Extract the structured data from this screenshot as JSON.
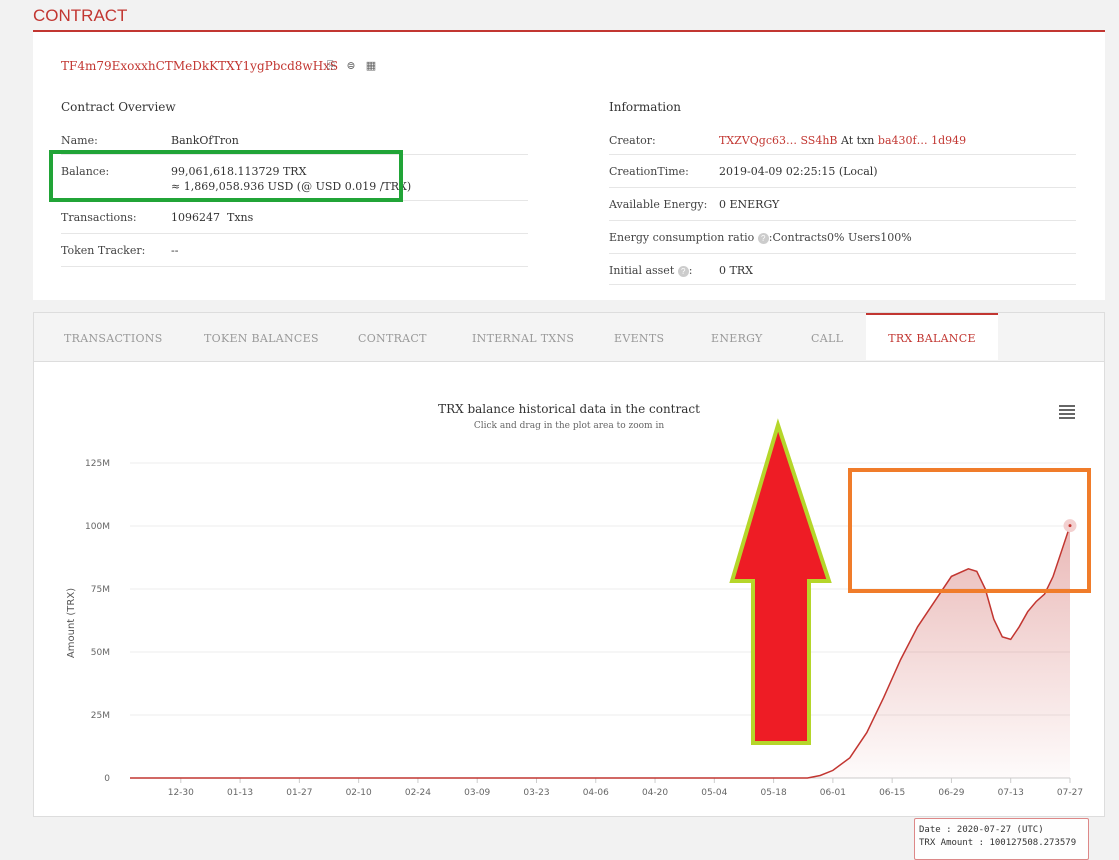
{
  "header": {
    "title": "CONTRACT"
  },
  "contract": {
    "address": "TF4m79ExoxxhCTMeDkKTXY1ygPbcd8wHxS"
  },
  "overview": {
    "title": "Contract Overview",
    "name_label": "Name:",
    "name_value": "BankOfTron",
    "balance_label": "Balance:",
    "balance_trx": "99,061,618.113729 TRX",
    "balance_usd": "≈ 1,869,058.936 USD (@ USD 0.019 /TRX)",
    "tx_label": "Transactions:",
    "tx_count": "1096247",
    "tx_unit": "Txns",
    "token_label": "Token Tracker:",
    "token_value": "--"
  },
  "information": {
    "title": "Information",
    "creator_label": "Creator:",
    "creator_value": "TXZVQgc63… SS4hB",
    "creator_at": "At txn",
    "creator_txn": "ba430f… 1d949",
    "ctime_label": "CreationTime:",
    "ctime_value": "2019-04-09 02:25:15 (Local)",
    "energy_label": "Available Energy:",
    "energy_value": "0  ENERGY",
    "ratio_label": "Energy consumption ratio",
    "ratio_value": ":Contracts0%  Users100%",
    "asset_label": "Initial asset",
    "asset_value": "0 TRX"
  },
  "tabs": [
    "TRANSACTIONS",
    "TOKEN BALANCES",
    "CONTRACT",
    "INTERNAL TXNS",
    "EVENTS",
    "ENERGY",
    "CALL",
    "TRX BALANCE"
  ],
  "active_tab": "TRX BALANCE",
  "tooltip": {
    "date": "Date : 2020-07-27 (UTC)",
    "amount": "TRX Amount : 100127508.273579"
  },
  "colors": {
    "accent": "#c23631",
    "annotation_green": "#21a437",
    "annotation_orange": "#f07c2a",
    "arrow_red": "#ee1c25",
    "arrow_outline": "#b5d62a"
  },
  "chart_data": {
    "type": "area",
    "title": "TRX balance historical data in the contract",
    "subtitle": "Click and drag in the plot area to zoom in",
    "ylabel": "Amount (TRX)",
    "ylim": [
      0,
      125000000
    ],
    "y_ticks": [
      "0",
      "25M",
      "50M",
      "75M",
      "100M",
      "125M"
    ],
    "y_tick_values": [
      0,
      25000000,
      50000000,
      75000000,
      100000000,
      125000000
    ],
    "x_ticks": [
      "12-30",
      "01-13",
      "01-27",
      "02-10",
      "02-24",
      "03-09",
      "03-23",
      "04-06",
      "04-20",
      "05-04",
      "05-18",
      "06-01",
      "06-15",
      "06-29",
      "07-13",
      "07-27"
    ],
    "x_ticks_days": [
      12,
      26,
      40,
      54,
      68,
      82,
      96,
      110,
      124,
      138,
      152,
      166,
      180,
      194,
      208,
      222
    ],
    "x_range_days": [
      0,
      222
    ],
    "series": [
      {
        "x": [
          0,
          20,
          60,
          100,
          140,
          155,
          160,
          163,
          166,
          170,
          174,
          178,
          182,
          186,
          190,
          194,
          198,
          200,
          202,
          204,
          206,
          208,
          210,
          212,
          214,
          216,
          218,
          220,
          222
        ],
        "y": [
          0,
          0,
          0,
          0,
          0,
          0,
          0,
          1000000,
          3000000,
          8000000,
          18000000,
          32000000,
          47000000,
          60000000,
          70000000,
          80000000,
          83000000,
          82000000,
          75000000,
          63000000,
          56000000,
          55000000,
          60000000,
          66000000,
          70000000,
          73000000,
          80000000,
          90000000,
          100127508
        ]
      }
    ],
    "grid": true
  }
}
